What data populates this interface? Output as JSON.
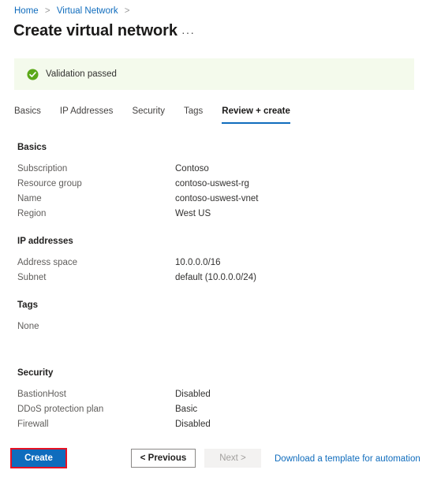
{
  "breadcrumb": {
    "items": [
      {
        "label": "Home"
      },
      {
        "label": "Virtual Network"
      }
    ],
    "separator": ">"
  },
  "header": {
    "title": "Create virtual network",
    "more_options": "···"
  },
  "validation": {
    "message": "Validation passed",
    "icon": "check-circle-icon",
    "status_color": "#5ba818",
    "background_color": "#f4faec"
  },
  "tabs": [
    {
      "label": "Basics",
      "active": false
    },
    {
      "label": "IP Addresses",
      "active": false
    },
    {
      "label": "Security",
      "active": false
    },
    {
      "label": "Tags",
      "active": false
    },
    {
      "label": "Review + create",
      "active": true
    }
  ],
  "sections": {
    "basics": {
      "heading": "Basics",
      "rows": [
        {
          "label": "Subscription",
          "value": "Contoso"
        },
        {
          "label": "Resource group",
          "value": "contoso-uswest-rg"
        },
        {
          "label": "Name",
          "value": "contoso-uswest-vnet"
        },
        {
          "label": "Region",
          "value": "West US"
        }
      ]
    },
    "ip_addresses": {
      "heading": "IP addresses",
      "rows": [
        {
          "label": "Address space",
          "value": "10.0.0.0/16"
        },
        {
          "label": "Subnet",
          "value": "default (10.0.0.0/24)"
        }
      ]
    },
    "tags": {
      "heading": "Tags",
      "value": "None"
    },
    "security": {
      "heading": "Security",
      "rows": [
        {
          "label": "BastionHost",
          "value": "Disabled"
        },
        {
          "label": "DDoS protection plan",
          "value": "Basic"
        },
        {
          "label": "Firewall",
          "value": "Disabled"
        }
      ]
    }
  },
  "footer": {
    "create_label": "Create",
    "previous_label": "< Previous",
    "next_label": "Next >",
    "download_link_label": "Download a template for automation",
    "create_highlight_color": "#e81123",
    "accent_color": "#0f6cbd"
  }
}
